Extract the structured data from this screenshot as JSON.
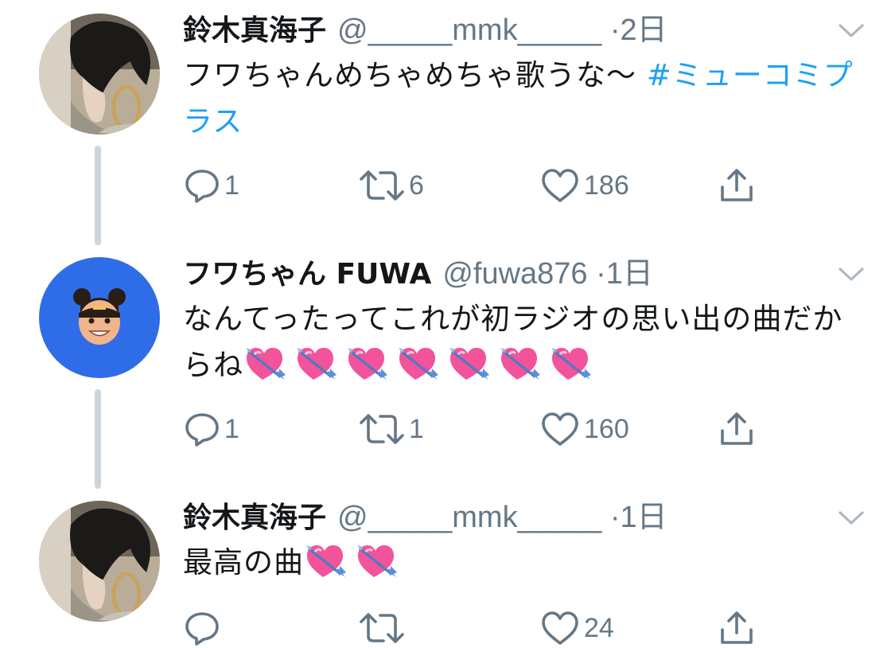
{
  "tweets": [
    {
      "name": "鈴木真海子",
      "handle": "@_____mmk_____",
      "separator": "·",
      "time": "2日",
      "text": "フワちゃんめちゃめちゃ歌うな〜 ",
      "hashtag": "#ミューコミプラス",
      "emoji_count": 0,
      "replies": "1",
      "retweets": "6",
      "likes": "186",
      "avatar": "woman-with-hoop-earring-photo"
    },
    {
      "name": "フワちゃん FUWA",
      "handle": "@fuwa876",
      "separator": "·",
      "time": "1日",
      "text": "なんてったってこれが初ラジオの思い出の曲だからね",
      "hashtag": "",
      "emoji": "heart-with-arrow",
      "emoji_count": 7,
      "replies": "1",
      "retweets": "1",
      "likes": "160",
      "avatar": "smiling-face-on-blue-background",
      "avatar_color": "#2f6de8"
    },
    {
      "name": "鈴木真海子",
      "handle": "@_____mmk_____",
      "separator": "·",
      "time": "1日",
      "text": "最高の曲",
      "hashtag": "",
      "emoji": "heart-with-arrow",
      "emoji_count": 2,
      "replies": "",
      "retweets": "",
      "likes": "24",
      "avatar": "woman-with-hoop-earring-photo"
    }
  ],
  "icons": {
    "reply": "speech-bubble-icon",
    "retweet": "retweet-arrows-icon",
    "like": "heart-outline-icon",
    "share": "share-upload-icon",
    "more": "chevron-down-icon"
  },
  "colors": {
    "text": "#14171a",
    "secondary": "#657786",
    "link": "#1da1f2",
    "thread_line": "#cdd5dc",
    "emoji_heart": "#f2539a",
    "emoji_arrow": "#5b8fd6"
  }
}
